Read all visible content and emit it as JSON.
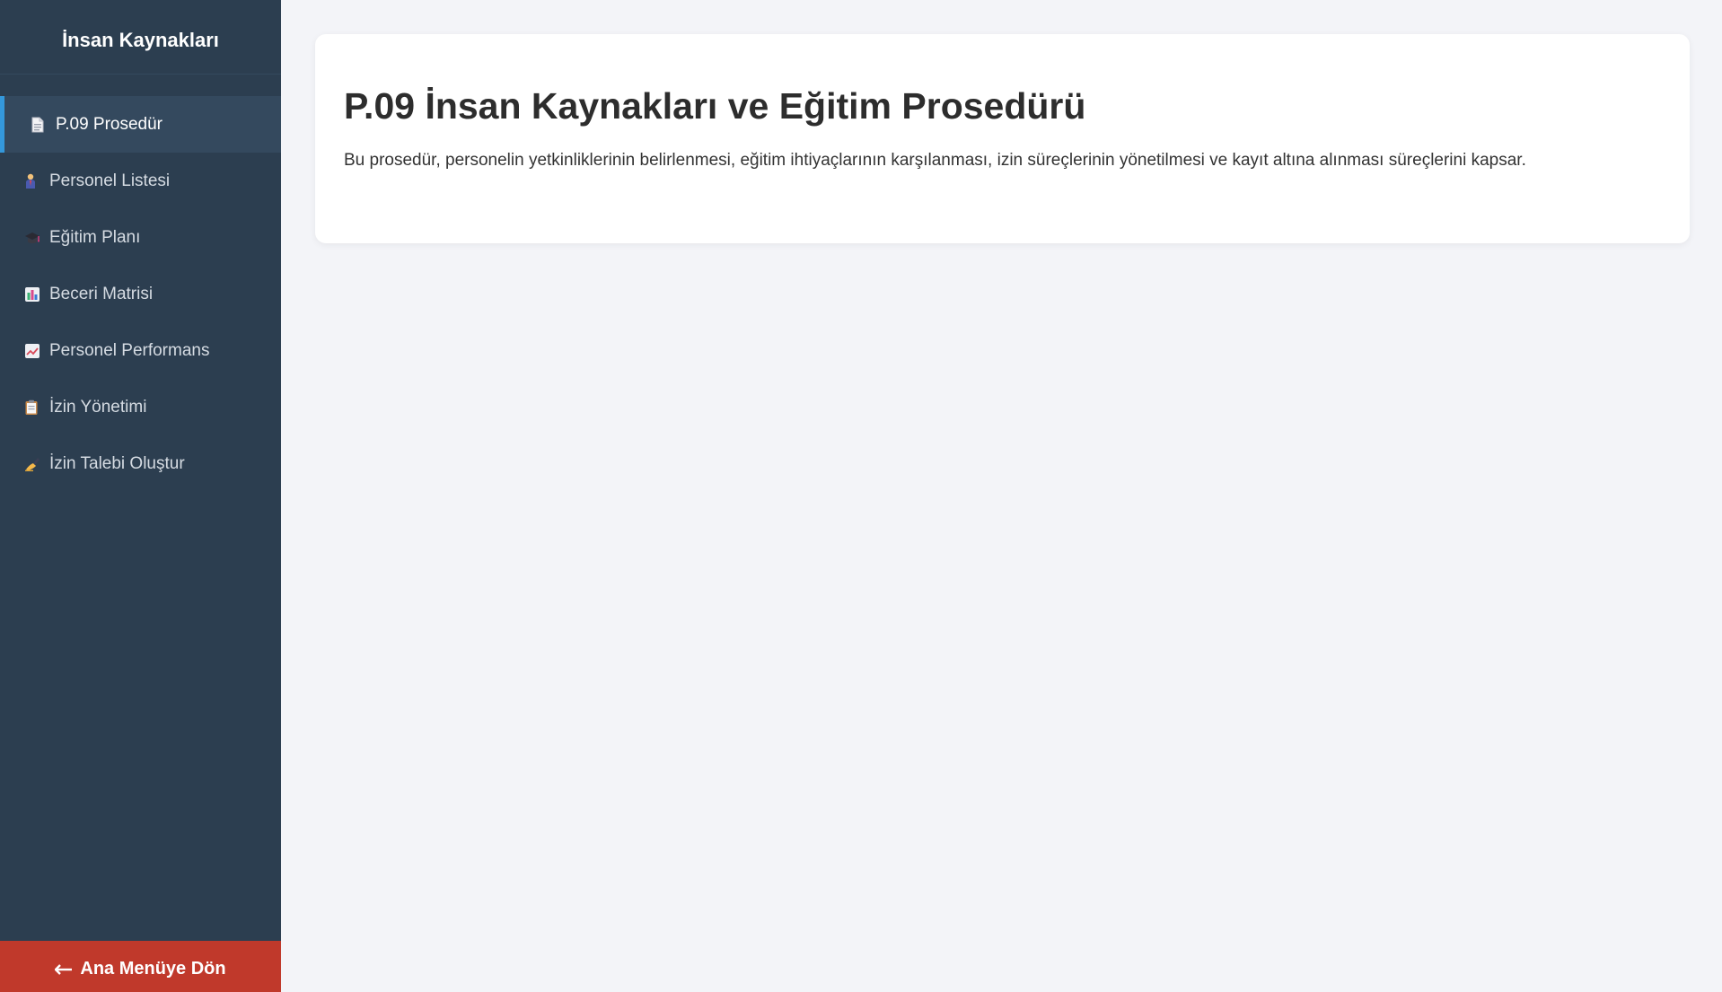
{
  "sidebar": {
    "title": "İnsan Kaynakları",
    "items": [
      {
        "label": "P.09 Prosedür",
        "icon": "document-icon",
        "active": true
      },
      {
        "label": "Personel Listesi",
        "icon": "person-icon",
        "active": false
      },
      {
        "label": "Eğitim Planı",
        "icon": "graduation-cap-icon",
        "active": false
      },
      {
        "label": "Beceri Matrisi",
        "icon": "bar-chart-icon",
        "active": false
      },
      {
        "label": "Personel Performans",
        "icon": "line-chart-icon",
        "active": false
      },
      {
        "label": "İzin Yönetimi",
        "icon": "clipboard-icon",
        "active": false
      },
      {
        "label": "İzin Talebi Oluştur",
        "icon": "writing-hand-icon",
        "active": false
      }
    ],
    "back_button": {
      "label": "Ana Menüye Dön",
      "icon": "arrow-left-icon"
    }
  },
  "main": {
    "title": "P.09 İnsan Kaynakları ve Eğitim Prosedürü",
    "description": "Bu prosedür, personelin yetkinliklerinin belirlenmesi, eğitim ihtiyaçlarının karşılanması, izin süreçlerinin yönetilmesi ve kayıt altına alınması süreçlerini kapsar."
  },
  "colors": {
    "sidebar_bg": "#2c3e50",
    "active_item_bg": "#34495e",
    "active_accent": "#3498db",
    "back_button_bg": "#c0392b",
    "page_bg": "#f3f4f8"
  }
}
